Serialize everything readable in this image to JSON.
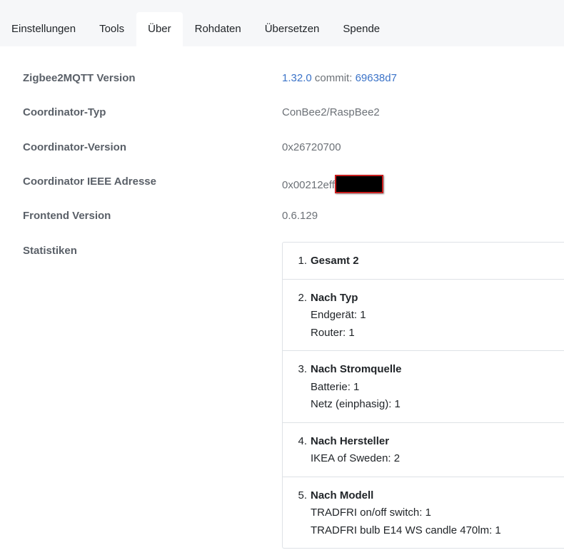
{
  "tabs": [
    {
      "label": "Einstellungen"
    },
    {
      "label": "Tools"
    },
    {
      "label": "Über"
    },
    {
      "label": "Rohdaten"
    },
    {
      "label": "Übersetzen"
    },
    {
      "label": "Spende"
    }
  ],
  "active_tab": "Über",
  "about": {
    "zigbee2mqtt_version": {
      "label": "Zigbee2MQTT Version",
      "version": "1.32.0",
      "commit_label": "commit:",
      "commit": "69638d7"
    },
    "coordinator_type": {
      "label": "Coordinator-Typ",
      "value": "ConBee2/RaspBee2"
    },
    "coordinator_version": {
      "label": "Coordinator-Version",
      "value": "0x26720700"
    },
    "coordinator_ieee": {
      "label": "Coordinator IEEE Adresse",
      "value": "0x00212eff"
    },
    "frontend_version": {
      "label": "Frontend Version",
      "value": "0.6.129"
    },
    "statistics": {
      "label": "Statistiken",
      "items": [
        {
          "num": "1.",
          "title": "Gesamt 2",
          "lines": []
        },
        {
          "num": "2.",
          "title": "Nach Typ",
          "lines": [
            "Endgerät: 1",
            "Router: 1"
          ]
        },
        {
          "num": "3.",
          "title": "Nach Stromquelle",
          "lines": [
            "Batterie: 1",
            "Netz (einphasig): 1"
          ]
        },
        {
          "num": "4.",
          "title": "Nach Hersteller",
          "lines": [
            "IKEA of Sweden: 2"
          ]
        },
        {
          "num": "5.",
          "title": "Nach Modell",
          "lines": [
            "TRADFRI on/off switch: 1",
            "TRADFRI bulb E14 WS candle 470lm: 1"
          ]
        }
      ]
    }
  },
  "colors": {
    "link": "#3b73c8",
    "tabbar_bg": "#f6f7f9",
    "redaction_border": "#c81e1e"
  }
}
